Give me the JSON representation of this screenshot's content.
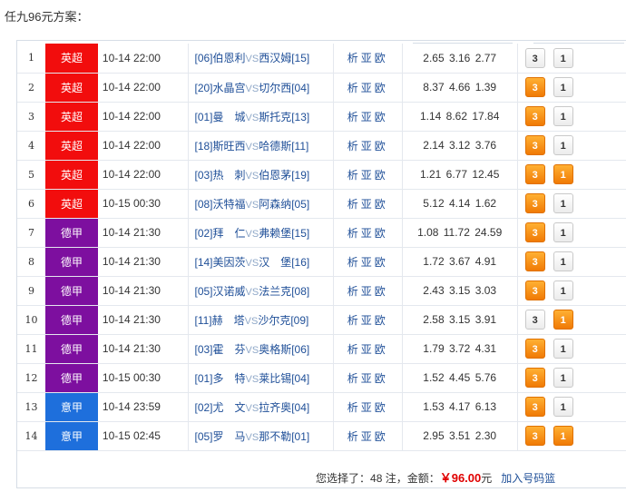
{
  "title": "任九96元方案：",
  "colors": {
    "epl": "#f20d0d",
    "bundesliga": "#7d0f9f",
    "seriea": "#1e6fdc",
    "selected": "#f5860d"
  },
  "links": [
    "析",
    "亚",
    "欧"
  ],
  "vs_text": "VS",
  "rows": [
    {
      "idx": "1",
      "league": "英超",
      "color": "#f20d0d",
      "time": "10-14 22:00",
      "home": "[06]伯恩利",
      "away": "西汉姆[15]",
      "o1": "2.65",
      "o2": "3.16",
      "o3": "2.77",
      "b1": "3",
      "b2": "1",
      "s1": false,
      "s2": false
    },
    {
      "idx": "2",
      "league": "英超",
      "color": "#f20d0d",
      "time": "10-14 22:00",
      "home": "[20]水晶宫",
      "away": "切尔西[04]",
      "o1": "8.37",
      "o2": "4.66",
      "o3": "1.39",
      "b1": "3",
      "b2": "1",
      "s1": true,
      "s2": false
    },
    {
      "idx": "3",
      "league": "英超",
      "color": "#f20d0d",
      "time": "10-14 22:00",
      "home": "[01]曼　城",
      "away": "斯托克[13]",
      "o1": "1.14",
      "o2": "8.62",
      "o3": "17.84",
      "b1": "3",
      "b2": "1",
      "s1": true,
      "s2": false
    },
    {
      "idx": "4",
      "league": "英超",
      "color": "#f20d0d",
      "time": "10-14 22:00",
      "home": "[18]斯旺西",
      "away": "哈德斯[11]",
      "o1": "2.14",
      "o2": "3.12",
      "o3": "3.76",
      "b1": "3",
      "b2": "1",
      "s1": true,
      "s2": false
    },
    {
      "idx": "5",
      "league": "英超",
      "color": "#f20d0d",
      "time": "10-14 22:00",
      "home": "[03]热　刺",
      "away": "伯恩茅[19]",
      "o1": "1.21",
      "o2": "6.77",
      "o3": "12.45",
      "b1": "3",
      "b2": "1",
      "s1": true,
      "s2": true
    },
    {
      "idx": "6",
      "league": "英超",
      "color": "#f20d0d",
      "time": "10-15 00:30",
      "home": "[08]沃特福",
      "away": "阿森纳[05]",
      "o1": "5.12",
      "o2": "4.14",
      "o3": "1.62",
      "b1": "3",
      "b2": "1",
      "s1": true,
      "s2": false
    },
    {
      "idx": "7",
      "league": "德甲",
      "color": "#7d0f9f",
      "time": "10-14 21:30",
      "home": "[02]拜　仁",
      "away": "弗赖堡[15]",
      "o1": "1.08",
      "o2": "11.72",
      "o3": "24.59",
      "b1": "3",
      "b2": "1",
      "s1": true,
      "s2": false
    },
    {
      "idx": "8",
      "league": "德甲",
      "color": "#7d0f9f",
      "time": "10-14 21:30",
      "home": "[14]美因茨",
      "away": "汉　堡[16]",
      "o1": "1.72",
      "o2": "3.67",
      "o3": "4.91",
      "b1": "3",
      "b2": "1",
      "s1": true,
      "s2": false
    },
    {
      "idx": "9",
      "league": "德甲",
      "color": "#7d0f9f",
      "time": "10-14 21:30",
      "home": "[05]汉诺威",
      "away": "法兰克[08]",
      "o1": "2.43",
      "o2": "3.15",
      "o3": "3.03",
      "b1": "3",
      "b2": "1",
      "s1": true,
      "s2": false
    },
    {
      "idx": "10",
      "league": "德甲",
      "color": "#7d0f9f",
      "time": "10-14 21:30",
      "home": "[11]赫　塔",
      "away": "沙尔克[09]",
      "o1": "2.58",
      "o2": "3.15",
      "o3": "3.91",
      "b1": "3",
      "b2": "1",
      "s1": false,
      "s2": true
    },
    {
      "idx": "11",
      "league": "德甲",
      "color": "#7d0f9f",
      "time": "10-14 21:30",
      "home": "[03]霍　芬",
      "away": "奥格斯[06]",
      "o1": "1.79",
      "o2": "3.72",
      "o3": "4.31",
      "b1": "3",
      "b2": "1",
      "s1": true,
      "s2": false
    },
    {
      "idx": "12",
      "league": "德甲",
      "color": "#7d0f9f",
      "time": "10-15 00:30",
      "home": "[01]多　特",
      "away": "莱比锡[04]",
      "o1": "1.52",
      "o2": "4.45",
      "o3": "5.76",
      "b1": "3",
      "b2": "1",
      "s1": true,
      "s2": false
    },
    {
      "idx": "13",
      "league": "意甲",
      "color": "#1e6fdc",
      "time": "10-14 23:59",
      "home": "[02]尤　文",
      "away": "拉齐奥[04]",
      "o1": "1.53",
      "o2": "4.17",
      "o3": "6.13",
      "b1": "3",
      "b2": "1",
      "s1": true,
      "s2": false
    },
    {
      "idx": "14",
      "league": "意甲",
      "color": "#1e6fdc",
      "time": "10-15 02:45",
      "home": "[05]罗　马",
      "away": "那不勒[01]",
      "o1": "2.95",
      "o2": "3.51",
      "o3": "2.30",
      "b1": "3",
      "b2": "1",
      "s1": true,
      "s2": true
    }
  ],
  "summary": {
    "prefix": "您选择了：",
    "count": "48",
    "count_suffix": " 注，金额：",
    "amount": "￥96.00",
    "amount_suffix": "元",
    "add_link": "加入号码篮"
  }
}
